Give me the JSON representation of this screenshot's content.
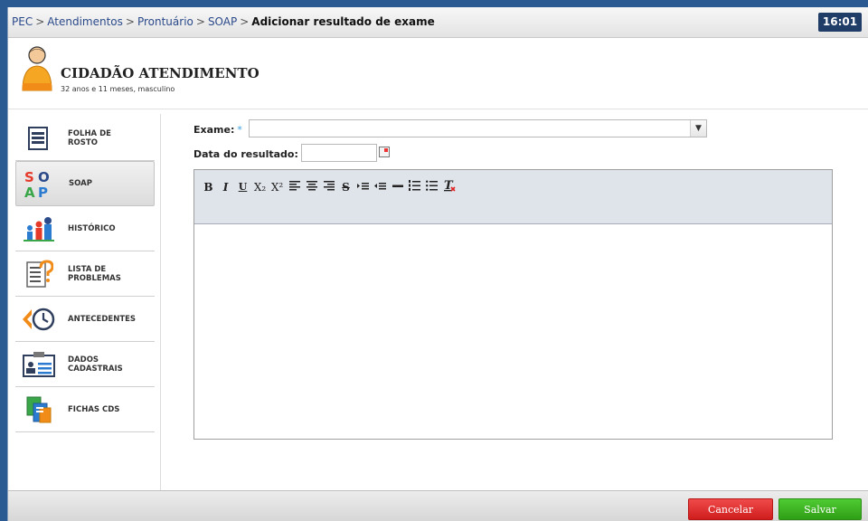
{
  "topbar": {
    "breadcrumb": [
      "PEC",
      "Atendimentos",
      "Prontuário",
      "SOAP"
    ],
    "current": "Adicionar resultado de exame",
    "separator": ">",
    "time": "16:01"
  },
  "patient": {
    "name": "CIDADÃO ATENDIMENTO",
    "info": "32 anos e 11 meses, masculino"
  },
  "sidebar": {
    "items": [
      {
        "label1": "FOLHA DE",
        "label2": "ROSTO",
        "icon": "document-icon",
        "active": false
      },
      {
        "label1": "SOAP",
        "label2": "",
        "icon": "soap-icon",
        "active": true
      },
      {
        "label1": "HISTÓRICO",
        "label2": "",
        "icon": "history-people-icon",
        "active": false
      },
      {
        "label1": "LISTA DE",
        "label2": "PROBLEMAS",
        "icon": "problem-list-icon",
        "active": false
      },
      {
        "label1": "ANTECEDENTES",
        "label2": "",
        "icon": "clock-back-icon",
        "active": false
      },
      {
        "label1": "DADOS",
        "label2": "CADASTRAIS",
        "icon": "id-card-icon",
        "active": false
      },
      {
        "label1": "FICHAS CDS",
        "label2": "",
        "icon": "forms-icon",
        "active": false
      }
    ]
  },
  "form": {
    "exam_label": "Exame:",
    "required_mark": "*",
    "exam_value": "",
    "date_label": "Data do resultado:",
    "date_value": ""
  },
  "editor": {
    "tools": [
      "B",
      "I",
      "U",
      "X₂",
      "X²",
      "align-left",
      "align-center",
      "align-right",
      "S",
      "indent",
      "outdent",
      "horizontal-rule",
      "ordered-list",
      "bullet-list",
      "clear-format"
    ],
    "content": ""
  },
  "footer": {
    "cancel": "Cancelar",
    "save": "Salvar"
  }
}
